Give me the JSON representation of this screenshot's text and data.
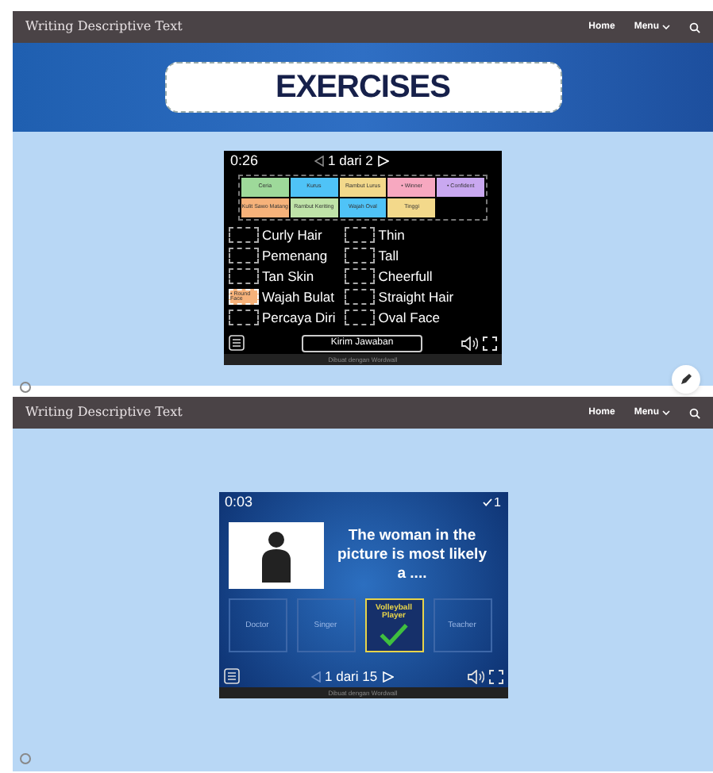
{
  "screens": [
    {
      "nav": {
        "title": "Writing Descriptive Text",
        "links": [
          "Home",
          "Menu"
        ]
      },
      "banner": {
        "title": "EXERCISES"
      },
      "edit_button": true,
      "game": {
        "kind": "match",
        "timer": "0:26",
        "pager": "1 dari 2",
        "submit": "Kirim Jawaban",
        "credit": "Dibuat dengan Wordwall",
        "cards": [
          {
            "label": "Ceria",
            "color": "#9ed99a"
          },
          {
            "label": "Kurus",
            "color": "#4fc3f7"
          },
          {
            "label": "Rambut Lurus",
            "color": "#f3d98b"
          },
          {
            "label": "• Winner",
            "color": "#f7a8c0"
          },
          {
            "label": "• Confident",
            "color": "#c9a8f0"
          },
          {
            "label": "Kulit Sawo Matang",
            "color": "#f6b27a"
          },
          {
            "label": "Rambut Keriting",
            "color": "#bfe3a8"
          },
          {
            "label": "Wajah Oval",
            "color": "#4fc3f7"
          },
          {
            "label": "Tinggi",
            "color": "#f3d98b"
          }
        ],
        "left": [
          {
            "term": "Curly Hair"
          },
          {
            "term": "Pemenang"
          },
          {
            "term": "Tan Skin"
          },
          {
            "term": "Wajah Bulat",
            "answer": "• Round Face"
          },
          {
            "term": "Percaya Diri"
          }
        ],
        "right": [
          {
            "term": "Thin"
          },
          {
            "term": "Tall"
          },
          {
            "term": "Cheerfull"
          },
          {
            "term": "Straight Hair"
          },
          {
            "term": "Oval Face"
          }
        ]
      }
    },
    {
      "nav": {
        "title": "Writing Descriptive Text",
        "links": [
          "Home",
          "Menu"
        ]
      },
      "game": {
        "kind": "quiz",
        "timer": "0:03",
        "score": "1",
        "question": "The woman in the picture is most likely a ....",
        "pager": "1 dari 15",
        "credit": "Dibuat dengan Wordwall",
        "options": [
          {
            "label": "Doctor",
            "selected": false
          },
          {
            "label": "Singer",
            "selected": false
          },
          {
            "label": "Volleyball Player",
            "selected": true
          },
          {
            "label": "Teacher",
            "selected": false
          }
        ]
      }
    }
  ]
}
